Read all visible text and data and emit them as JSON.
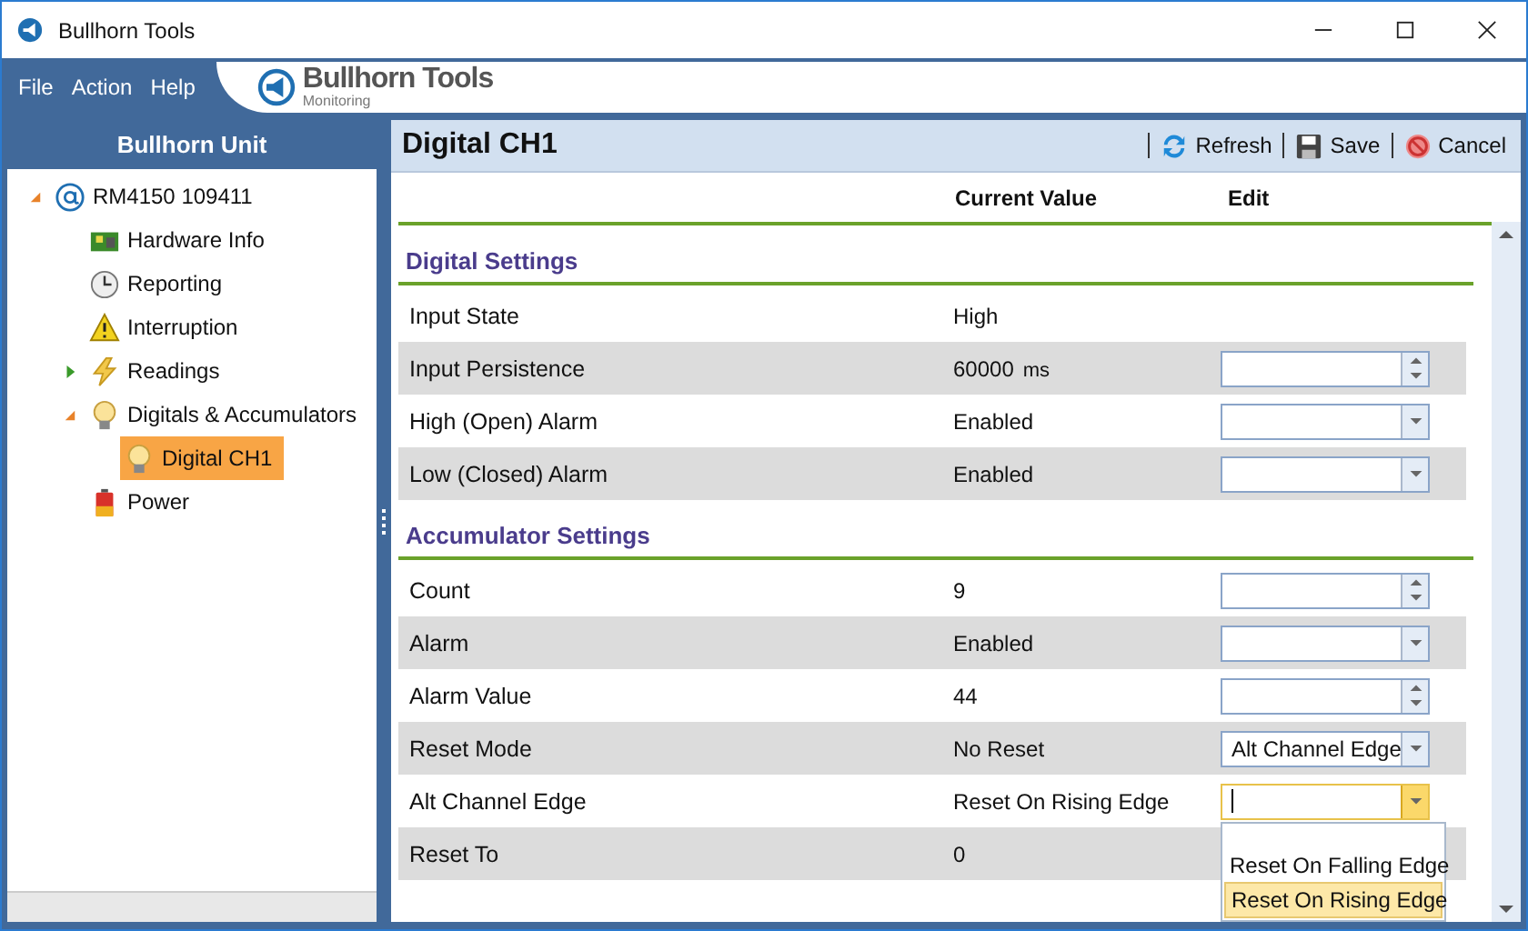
{
  "window": {
    "title": "Bullhorn Tools"
  },
  "menu": [
    "File",
    "Action",
    "Help"
  ],
  "logo": {
    "name": "Bullhorn",
    "name_2": "Tools",
    "subtitle": "Monitoring"
  },
  "sidebar": {
    "title": "Bullhorn Unit",
    "tree": [
      {
        "label": "RM4150 109411",
        "kind": "device",
        "expanded": true,
        "selected": false,
        "children": [
          {
            "label": "Hardware Info",
            "kind": "hardware",
            "selected": false
          },
          {
            "label": "Reporting",
            "kind": "clock",
            "selected": false
          },
          {
            "label": "Interruption",
            "kind": "warning",
            "selected": false
          },
          {
            "label": "Readings",
            "kind": "lightning",
            "expanded": false,
            "selected": false
          },
          {
            "label": "Digitals & Accumulators",
            "kind": "bulb",
            "expanded": true,
            "selected": false,
            "children": [
              {
                "label": "Digital CH1",
                "kind": "bulb",
                "selected": true
              }
            ]
          },
          {
            "label": "Power",
            "kind": "battery",
            "selected": false
          }
        ]
      }
    ]
  },
  "panel": {
    "title": "Digital CH1",
    "toolbar": [
      {
        "label": "Refresh",
        "kind": "refresh"
      },
      {
        "label": "Save",
        "kind": "save"
      },
      {
        "label": "Cancel",
        "kind": "cancel"
      }
    ],
    "columns": [
      "Current Value",
      "Edit"
    ],
    "sections": [
      {
        "title": "Digital Settings",
        "rows": [
          {
            "label": "Input State",
            "value": "High"
          },
          {
            "label": "Input Persistence",
            "value": "60000",
            "unit": "ms",
            "editor": {
              "kind": "spin"
            }
          },
          {
            "label": "High (Open) Alarm",
            "value": "Enabled",
            "editor": {
              "kind": "combo"
            }
          },
          {
            "label": "Low (Closed) Alarm",
            "value": "Enabled",
            "editor": {
              "kind": "combo"
            }
          }
        ]
      },
      {
        "title": "Accumulator Settings",
        "rows": [
          {
            "label": "Count",
            "value": "9",
            "editor": {
              "kind": "spin"
            }
          },
          {
            "label": "Alarm",
            "value": "Enabled",
            "editor": {
              "kind": "combo"
            }
          },
          {
            "label": "Alarm Value",
            "value": "44",
            "editor": {
              "kind": "spin"
            }
          },
          {
            "label": "Reset Mode",
            "value": "No Reset",
            "editor": {
              "kind": "combo",
              "value": "Alt Channel Edge"
            }
          },
          {
            "label": "Alt Channel Edge",
            "value": "Reset On Rising Edge",
            "editor": {
              "kind": "combo",
              "focused": true,
              "open": true,
              "options": [
                {
                  "label": "Reset On Falling Edge",
                  "selected": false
                },
                {
                  "label": "Reset On Rising Edge",
                  "selected": true
                }
              ]
            }
          },
          {
            "label": "Reset To",
            "value": "0"
          }
        ]
      }
    ]
  }
}
